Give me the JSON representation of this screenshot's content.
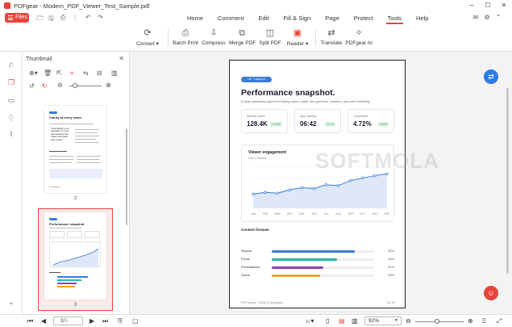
{
  "window": {
    "title": "PDFgear - Modern_PDF_Viewer_Test_Sample.pdf"
  },
  "files_button": {
    "label": "Files"
  },
  "menus": [
    "Home",
    "Comment",
    "Edit",
    "Fill & Sign",
    "Page",
    "Protect",
    "Tools",
    "Help"
  ],
  "active_menu": "Tools",
  "toolbar": {
    "convert": "Convert",
    "batch_print": "Batch Print",
    "compress": "Compress",
    "merge_pdf": "Merge PDF",
    "split_pdf": "Split PDF",
    "reader": "Reader",
    "translate": "Translate",
    "pdfgear_ai": "PDFgear AI"
  },
  "thumbnail_panel": {
    "title": "Thumbnail",
    "thumbs": [
      {
        "number": "2",
        "heading": "Clarity at every scale.",
        "quote": "\"Good design is not decoration. It is the quiet structure that makes information easy to trust.\""
      },
      {
        "number": "3",
        "heading": "Performance snapshot"
      }
    ]
  },
  "page": {
    "pill": "UX · Layout & Typography",
    "title": "Performance snapshot.",
    "subtitle": "A clean dashboard layout for testing vector charts, fine grid lines, numbers, and color rendering.",
    "cards": [
      {
        "label": "Monthly views",
        "value": "128.4K",
        "badge": "+12.8%"
      },
      {
        "label": "Avg. reading",
        "value": "06:42",
        "badge": "+4.1%"
      },
      {
        "label": "Conversion",
        "value": "4.72%",
        "badge": "+0.6%"
      }
    ],
    "content_formats": {
      "title": "Content formats",
      "rows": [
        {
          "name": "Reports",
          "percent": 82,
          "label": "82%",
          "color": "#3a7bd5"
        },
        {
          "name": "Forms",
          "percent": 64,
          "label": "64%",
          "color": "#2bb5a8"
        },
        {
          "name": "Presentations",
          "percent": 51,
          "label": "51%",
          "color": "#8e44ad"
        },
        {
          "name": "Scans",
          "percent": 48,
          "label": "48%",
          "color": "#e8a42b"
        }
      ]
    },
    "footer_left": "PDF Sample · Vector & Typography",
    "footer_right": "03 / 03"
  },
  "chart_data": {
    "type": "area",
    "title": "Viewer engagement",
    "subtitle": "Last 12 months",
    "categories": [
      "JAN",
      "FEB",
      "MAR",
      "APR",
      "MAY",
      "JUN",
      "JUL",
      "AUG",
      "SEP",
      "OCT",
      "NOV",
      "DEC"
    ],
    "values": [
      34,
      38,
      36,
      44,
      49,
      47,
      56,
      54,
      66,
      72,
      78,
      82
    ],
    "ylim": [
      0,
      100
    ],
    "grid": true,
    "colors": {
      "line": "#3a7bd5",
      "fill": "#dfe8fb"
    }
  },
  "watermark": "SOFTMOLA",
  "statusbar": {
    "current_page": "3",
    "total_pages": "/5",
    "zoom": "92%"
  },
  "accent_color": "#e5453a"
}
